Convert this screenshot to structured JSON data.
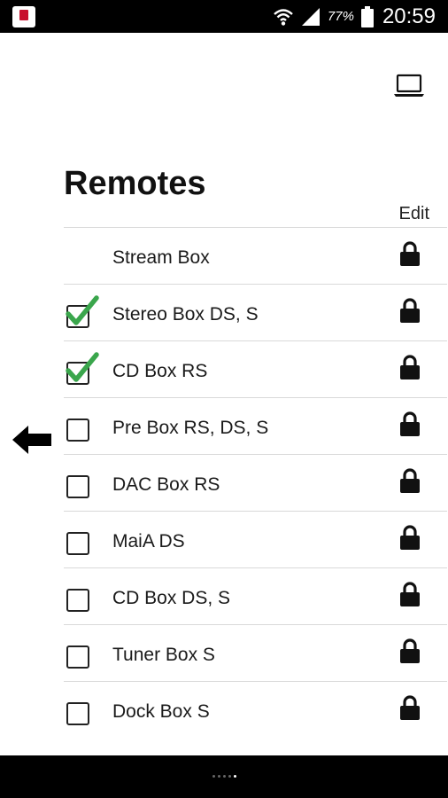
{
  "status_bar": {
    "battery_percent": "77%",
    "time": "20:59"
  },
  "header": {
    "title": "Remotes",
    "edit_label": "Edit"
  },
  "remotes": [
    {
      "label": "Stream Box",
      "checkbox": "none",
      "locked": true
    },
    {
      "label": "Stereo Box DS, S",
      "checkbox": "checked",
      "locked": true
    },
    {
      "label": "CD Box RS",
      "checkbox": "checked",
      "locked": true
    },
    {
      "label": "Pre Box RS, DS, S",
      "checkbox": "unchecked",
      "locked": true
    },
    {
      "label": "DAC Box RS",
      "checkbox": "unchecked",
      "locked": true
    },
    {
      "label": "MaiA DS",
      "checkbox": "unchecked",
      "locked": true
    },
    {
      "label": "CD Box DS, S",
      "checkbox": "unchecked",
      "locked": true
    },
    {
      "label": "Tuner Box S",
      "checkbox": "unchecked",
      "locked": true
    },
    {
      "label": "Dock Box S",
      "checkbox": "unchecked",
      "locked": true
    }
  ],
  "colors": {
    "check_green": "#3aa64c",
    "status_bar": "#000000",
    "text": "#1a1a1a"
  },
  "icons": [
    "app-icon",
    "wifi-icon",
    "signal-icon",
    "battery-icon",
    "laptop-icon",
    "lock-icon",
    "checkmark-icon",
    "back-arrow-icon"
  ]
}
